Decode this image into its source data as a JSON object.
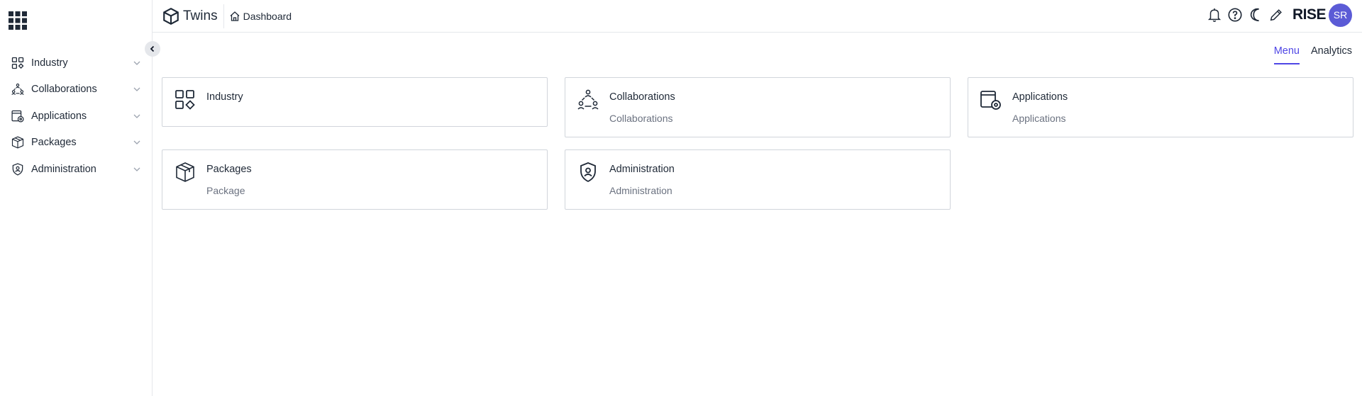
{
  "sidebar": {
    "apps_icon": "grid-apps-icon",
    "collapse_icon": "chevron-left-icon",
    "items": [
      {
        "label": "Industry",
        "icon": "industry-widgets-icon"
      },
      {
        "label": "Collaborations",
        "icon": "collaborations-people-icon"
      },
      {
        "label": "Applications",
        "icon": "applications-gear-icon"
      },
      {
        "label": "Packages",
        "icon": "package-box-icon"
      },
      {
        "label": "Administration",
        "icon": "shield-user-icon"
      }
    ]
  },
  "header": {
    "brand": "Twins",
    "breadcrumb": "Dashboard",
    "org": "RISE",
    "avatar_initials": "SR",
    "tools": [
      "bell-icon",
      "help-icon",
      "moon-icon",
      "pencil-icon"
    ]
  },
  "tabs": [
    {
      "label": "Menu",
      "active": true
    },
    {
      "label": "Analytics",
      "active": false
    }
  ],
  "cards": [
    {
      "title": "Industry",
      "subtitle": ""
    },
    {
      "title": "Collaborations",
      "subtitle": "Collaborations"
    },
    {
      "title": "Applications",
      "subtitle": "Applications"
    },
    {
      "title": "Packages",
      "subtitle": "Package"
    },
    {
      "title": "Administration",
      "subtitle": "Administration"
    }
  ],
  "colors": {
    "accent": "#4f46e5",
    "avatar_bg": "#5b5bd6",
    "border": "#d1d5db",
    "text": "#1f2937",
    "muted": "#6b7280"
  }
}
